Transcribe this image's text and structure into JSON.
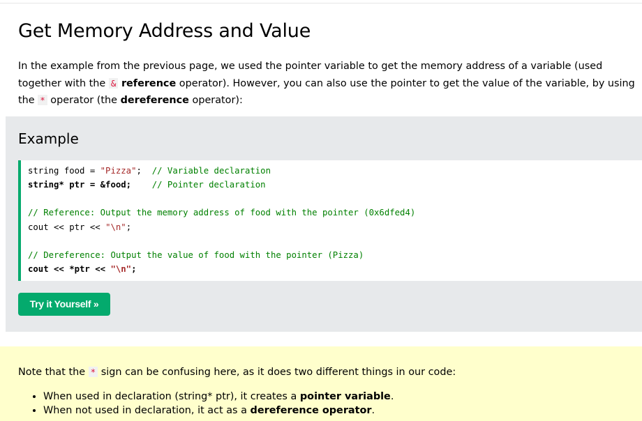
{
  "page_title": "Get Memory Address and Value",
  "intro": {
    "t1": "In the example from the previous page, we used the pointer variable to get the memory address of a variable (used together with the ",
    "ref_op": "&",
    "t2": " ",
    "ref_word": "reference",
    "t3": " operator). However, you can also use the pointer to get the value of the variable, by using the ",
    "deref_op": "*",
    "t4": " operator (the ",
    "deref_word": "dereference",
    "t5": " operator):"
  },
  "example": {
    "heading": "Example",
    "code": {
      "l1_a": "string food = ",
      "l1_str": "\"Pizza\"",
      "l1_b": ";  ",
      "l1_cmt": "// Variable declaration",
      "l2_a": "string* ptr = &food;    ",
      "l2_cmt": "// Pointer declaration",
      "l3_cmt": "// Reference: Output the memory address of food with the pointer (0x6dfed4)",
      "l4_a": "cout << ptr << ",
      "l4_str": "\"\\n\"",
      "l4_b": ";",
      "l5_cmt": "// Dereference: Output the value of food with the pointer (Pizza)",
      "l6_a": "cout << *ptr << ",
      "l6_str": "\"\\n\"",
      "l6_b": ";"
    },
    "button_label": "Try it Yourself »"
  },
  "note": {
    "t1": "Note that the ",
    "op": "*",
    "t2": " sign can be confusing here, as it does two different things in our code:",
    "items": [
      {
        "text": "When used in declaration (string* ptr), it creates a ",
        "bold": "pointer variable",
        "end": "."
      },
      {
        "text": "When not used in declaration, it act as a ",
        "bold": "dereference operator",
        "end": "."
      }
    ]
  },
  "colors": {
    "accent_green": "#04aa6d",
    "code_string": "#a52a2a",
    "code_comment": "#008000",
    "inline_code_red": "#dc143c",
    "example_bg": "#e7e9eb",
    "note_bg": "#ffffcc"
  }
}
